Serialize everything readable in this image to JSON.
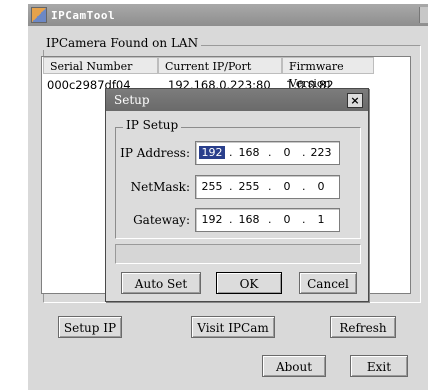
{
  "window": {
    "title": "IPCamTool",
    "group_title": "IPCamera Found on LAN",
    "columns": [
      "Serial Number",
      "Current IP/Port",
      "Firmware Version"
    ],
    "rows": [
      {
        "serial": "000c2987df04",
        "ip_port": "192.168.0.223:80",
        "firmware": "1.0.0.82"
      }
    ],
    "buttons": {
      "setup_ip": "Setup IP",
      "visit_ipcam": "Visit IPCam",
      "refresh": "Refresh",
      "about": "About",
      "exit": "Exit"
    }
  },
  "dialog": {
    "title": "Setup",
    "close": "×",
    "group_title": "IP Setup",
    "fields": {
      "ip_address": {
        "label": "IP Address:",
        "octets": [
          "192",
          "168",
          "0",
          "223"
        ]
      },
      "net_mask": {
        "label": "NetMask:",
        "octets": [
          "255",
          "255",
          "0",
          "0"
        ]
      },
      "gateway": {
        "label": "Gateway:",
        "octets": [
          "192",
          "168",
          "0",
          "1"
        ]
      }
    },
    "buttons": {
      "auto_set": "Auto Set",
      "ok": "OK",
      "cancel": "Cancel"
    }
  }
}
